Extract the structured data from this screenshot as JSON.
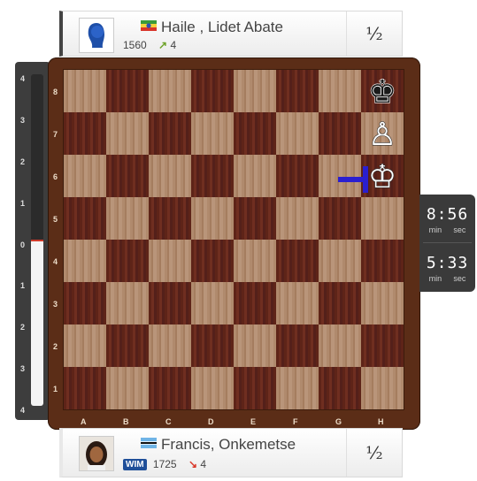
{
  "top_player": {
    "name": "Haile , Lidet Abate",
    "rating": "1560",
    "rating_change": "4",
    "rating_direction": "up",
    "flag": "ethiopia-flag",
    "result": "½"
  },
  "bottom_player": {
    "name": "Francis, Onkemetse",
    "title": "WIM",
    "rating": "1725",
    "rating_change": "4",
    "rating_direction": "down",
    "flag": "botswana-flag",
    "result": "½"
  },
  "eval_bar": {
    "labels": [
      "4",
      "3",
      "2",
      "1",
      "0",
      "1",
      "2",
      "3",
      "4"
    ],
    "evaluation": 0,
    "colors": {
      "white": "#f4f4f4",
      "black": "#2b2b2b",
      "marker": "#cf3a2a"
    }
  },
  "board": {
    "ranks": [
      "8",
      "7",
      "6",
      "5",
      "4",
      "3",
      "2",
      "1"
    ],
    "files": [
      "A",
      "B",
      "C",
      "D",
      "E",
      "F",
      "G",
      "H"
    ],
    "pieces": [
      {
        "square": "h8",
        "piece": "black-king-icon",
        "glyph": "♚"
      },
      {
        "square": "h7",
        "piece": "white-pawn-icon",
        "glyph": "♙"
      },
      {
        "square": "h6",
        "piece": "white-king-icon",
        "glyph": "♔"
      }
    ],
    "last_move_arrow": {
      "from": "g6",
      "to": "h6",
      "color": "#2a1fd0"
    },
    "colors": {
      "light": "#b08a6d",
      "dark": "#5e2418",
      "frame": "#5b2d17"
    }
  },
  "clocks": {
    "top": {
      "time": "8:56",
      "min_label": "min",
      "sec_label": "sec"
    },
    "bottom": {
      "time": "5:33",
      "min_label": "min",
      "sec_label": "sec"
    }
  }
}
